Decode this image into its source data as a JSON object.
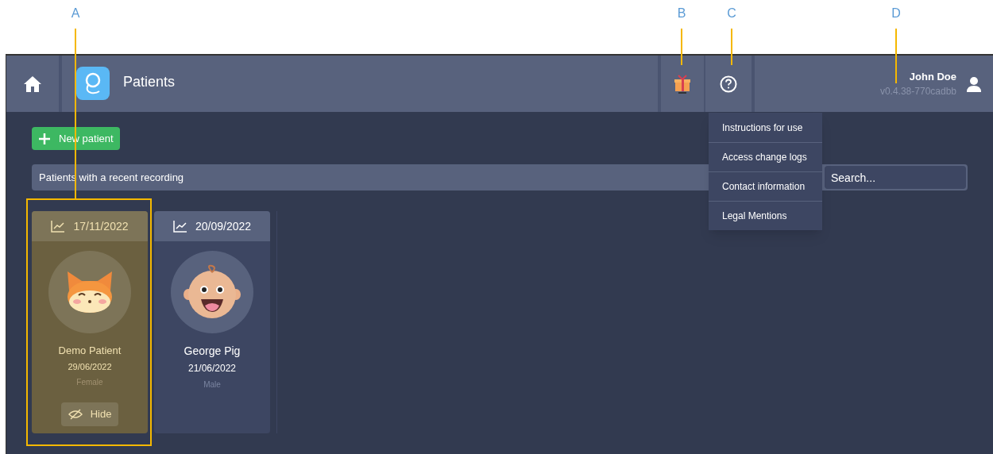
{
  "annotations": [
    {
      "label": "A"
    },
    {
      "label": "B"
    },
    {
      "label": "C"
    },
    {
      "label": "D"
    }
  ],
  "header": {
    "title": "Patients",
    "user_name": "John Doe",
    "version": "v0.4.38-770cadbb"
  },
  "help_menu": {
    "open": true,
    "items": [
      "Instructions for use",
      "Access change logs",
      "Contact information",
      "Legal Mentions"
    ]
  },
  "new_patient_button": "New patient",
  "section": {
    "title": "Patients with a recent recording",
    "search_placeholder": "Search..."
  },
  "cards": [
    {
      "date": "17/11/2022",
      "kind": "fox",
      "name": "Demo Patient",
      "birthdate": "29/06/2022",
      "gender": "Female",
      "highlighted": true,
      "hide_label": "Hide"
    },
    {
      "date": "20/09/2022",
      "kind": "baby",
      "name": "George Pig",
      "birthdate": "21/06/2022",
      "gender": "Male",
      "highlighted": false
    }
  ]
}
